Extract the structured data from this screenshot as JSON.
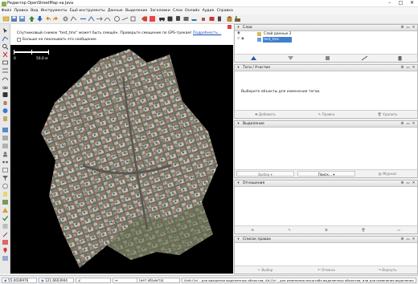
{
  "window": {
    "title": "Редактор OpenStreetMap на Java",
    "minimize": "–",
    "maximize": "□",
    "close": "✕"
  },
  "menu": [
    "Файл",
    "Правка",
    "Вид",
    "Инструменты",
    "Ещё инструменты",
    "Данные",
    "Выделение",
    "Заголовки",
    "Слои",
    "Онлайн",
    "Аудио",
    "Справка"
  ],
  "message": {
    "text": "Спутниковый снимок \"test_tms\" может быть смещён. Проверьте смещение по GPS-трекам!",
    "link": "Подробность...",
    "checkbox_label": "Больше не показывать это сообщение"
  },
  "scale": {
    "left": "0",
    "right": "50,0 м"
  },
  "layers": {
    "title": "Слои",
    "items": [
      {
        "name": "Слой данных 2",
        "active": false
      },
      {
        "name": "test_tms",
        "active": true
      }
    ]
  },
  "tags": {
    "title": "Теги / Участие",
    "empty_text": "Выберите объекты для изменения тегов.",
    "buttons": [
      "Добавить",
      "Правка",
      "Удалить"
    ]
  },
  "selection": {
    "title": "Выделение",
    "buttons": [
      "Выбор",
      "Поиск...",
      "Журнал"
    ]
  },
  "relations": {
    "title": "Отношения"
  },
  "conflicts": {
    "title": "Список правок",
    "buttons": [
      "Выбор",
      "Отмена",
      "Вернуть"
    ]
  },
  "status": {
    "lat": "55.0036976",
    "lon": "121.6603944",
    "dist": "",
    "selection": "(нет объекта)",
    "hint": "Shift-Ctrl – для вращения выделенных объектов; Alt-Ctrl – для изменения масштаба выделенных объектов; или для изменения выделения"
  },
  "colors": {
    "selected_layer": "#3f7fd0",
    "map_bg": "#000000"
  }
}
